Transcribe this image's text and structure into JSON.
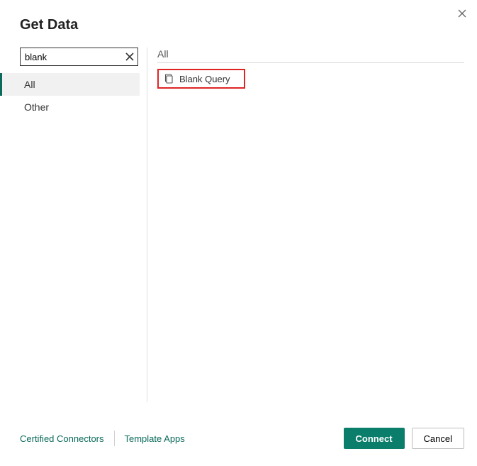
{
  "title": "Get Data",
  "search": {
    "value": "blank"
  },
  "categories": [
    {
      "label": "All",
      "selected": true
    },
    {
      "label": "Other",
      "selected": false
    }
  ],
  "main": {
    "header": "All",
    "results": [
      {
        "label": "Blank Query"
      }
    ]
  },
  "footer": {
    "links": {
      "certified": "Certified Connectors",
      "template": "Template Apps"
    },
    "buttons": {
      "connect": "Connect",
      "cancel": "Cancel"
    }
  }
}
